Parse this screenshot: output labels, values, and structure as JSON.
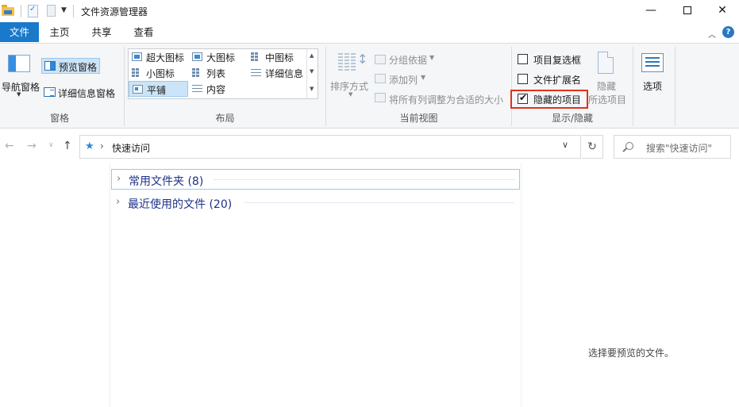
{
  "window": {
    "title": "文件资源管理器",
    "minimize_symbol": "—",
    "close_symbol": "✕"
  },
  "ribbon_tabs": {
    "file": "文件",
    "home": "主页",
    "share": "共享",
    "view": "查看"
  },
  "ribbon": {
    "panes": {
      "nav_pane": "导航窗格",
      "preview_pane": "预览窗格",
      "details_pane": "详细信息窗格",
      "group_label": "窗格"
    },
    "layout": {
      "items": [
        "超大图标",
        "大图标",
        "中图标",
        "小图标",
        "列表",
        "详细信息",
        "平铺",
        "内容"
      ],
      "selected": "平铺",
      "group_label": "布局"
    },
    "current_view": {
      "sort_by": "排序方式",
      "group_by": "分组依据",
      "add_column": "添加列",
      "size_all_columns": "将所有列调整为合适的大小",
      "group_label": "当前视图"
    },
    "show_hide": {
      "item_checkboxes": "项目复选框",
      "item_checkboxes_checked": false,
      "file_extensions": "文件扩展名",
      "file_extensions_checked": false,
      "hidden_items": "隐藏的项目",
      "hidden_items_checked": true,
      "hide_selected": "隐藏",
      "hide_selected_2": "所选项目",
      "group_label": "显示/隐藏"
    },
    "options": "选项"
  },
  "address_bar": {
    "path": "快速访问",
    "search_placeholder": "搜索\"快速访问\""
  },
  "content": {
    "sections": [
      {
        "title": "常用文件夹 (8)",
        "expanded": false
      },
      {
        "title": "最近使用的文件 (20)",
        "expanded": false
      }
    ],
    "preview_message": "选择要预览的文件。"
  },
  "colors": {
    "accent": "#1979ca",
    "selection": "#cce4f7",
    "highlight_box": "#e3311b",
    "section_title": "#1e3287"
  }
}
